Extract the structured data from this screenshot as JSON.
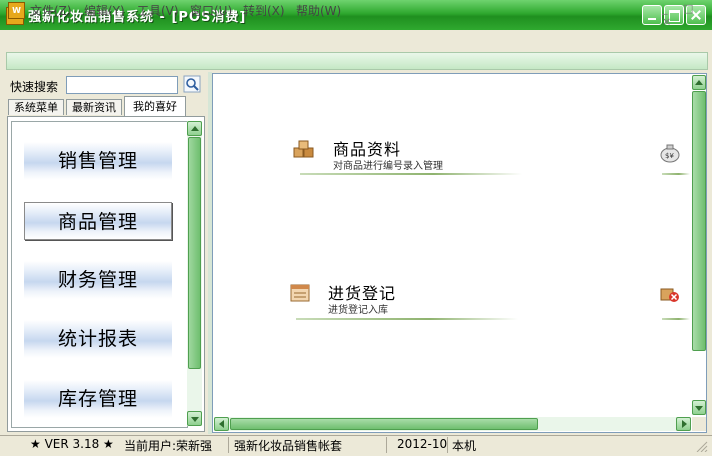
{
  "window": {
    "title": "强新化妆品销售系统 - [POS消费]",
    "app_icon_text": "W"
  },
  "menu": {
    "items": [
      "文件(Z)",
      "编辑(Y)",
      "工具(V)",
      "窗口(U)",
      "转到(X)",
      "帮助(W)"
    ],
    "mdi_buttons": "_ □ ×"
  },
  "sidebar": {
    "search_label": "快速搜索",
    "search_placeholder": "",
    "tabs": [
      "系统菜单",
      "最新资讯",
      "我的喜好"
    ],
    "active_tab": "我的喜好",
    "nav_items": [
      "销售管理",
      "商品管理",
      "财务管理",
      "统计报表",
      "库存管理"
    ],
    "selected_item": "商品管理"
  },
  "main": {
    "items": [
      {
        "title": "商品资料",
        "desc": "对商品进行编号录入管理"
      },
      {
        "title": "进货登记",
        "desc": "进货登记入库"
      }
    ]
  },
  "status": {
    "version": "★ VER 3.18 ★",
    "user": "当前用户:荣新强",
    "account": "强新化妆品销售帐套",
    "period": "2012-10",
    "location": "本机"
  },
  "colors": {
    "titlebar": "#2ea82e",
    "accent_green": "#6fbf6f",
    "nav_button_blue": "#c6d7ef",
    "panel_bg": "#ece9d8"
  }
}
